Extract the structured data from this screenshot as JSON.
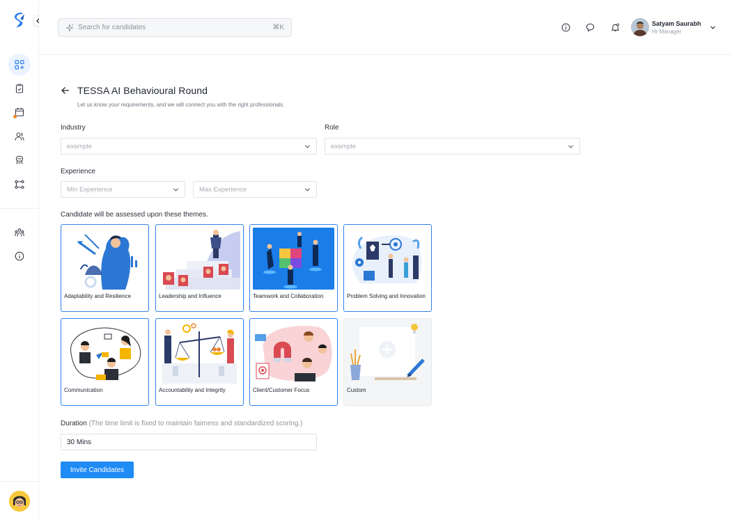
{
  "colors": {
    "accent": "#1f8bf4",
    "selected_border": "#2f80ed",
    "notification_dot": "#f08a24"
  },
  "sidebar": {
    "items": [
      {
        "icon": "dashboard-plus-icon",
        "active": true
      },
      {
        "icon": "clipboard-check-icon"
      },
      {
        "icon": "calendar-icon",
        "badge": true
      },
      {
        "icon": "users-icon"
      },
      {
        "icon": "interviewer-icon"
      },
      {
        "icon": "workflow-icon"
      },
      {
        "icon": "team-icon"
      },
      {
        "icon": "info-icon"
      }
    ]
  },
  "topbar": {
    "search_placeholder": "Search for candidates",
    "search_shortcut": "⌘K",
    "user_name": "Satyam Saurabh",
    "user_role": "Hr Manager"
  },
  "page": {
    "title": "TESSA AI Behavioural Round",
    "subtitle": "Let us know your requirements, and we will connect you with the right professionals.",
    "industry_label": "Industry",
    "industry_placeholder": "example",
    "role_label": "Role",
    "role_placeholder": "example",
    "experience_label": "Experience",
    "min_experience_placeholder": "Min Experience",
    "max_experience_placeholder": "Max Experience",
    "themes_label": "Candidate will be assessed upon these themes.",
    "themes": [
      {
        "label": "Adaptability and Resilience",
        "selected": true
      },
      {
        "label": "Leadership and Influence",
        "selected": true
      },
      {
        "label": "Teamwork and Collaboration",
        "selected": true
      },
      {
        "label": "Problem Solving and Innovation",
        "selected": true
      },
      {
        "label": "Communication",
        "selected": true
      },
      {
        "label": "Accountability and Integrity",
        "selected": true
      },
      {
        "label": "Client/Customer Focus",
        "selected": true
      },
      {
        "label": "Custom",
        "selected": false
      }
    ],
    "duration_label": "Duration",
    "duration_note": "(The time limit is fixed to maintain fairness and standardized scoring.)",
    "duration_value": "30 Mins",
    "invite_button": "Invite Candidates"
  }
}
